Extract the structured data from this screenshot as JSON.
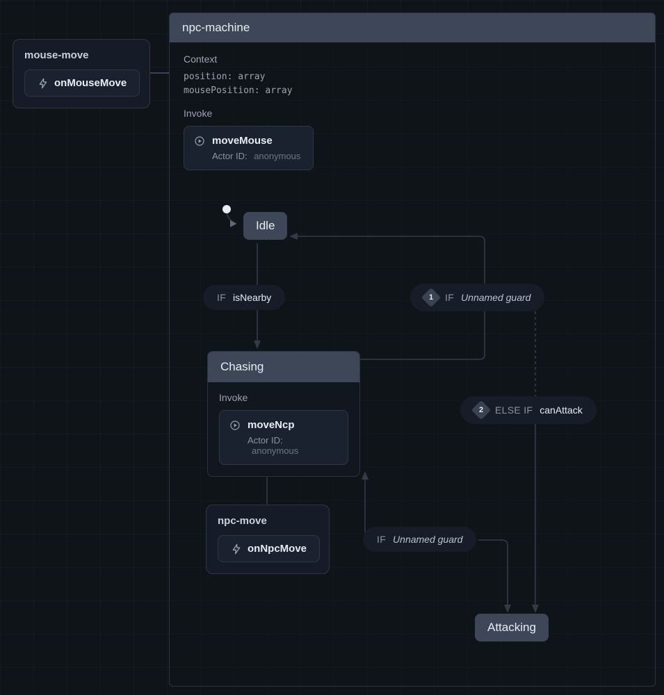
{
  "machine": {
    "name": "npc-machine",
    "context": {
      "heading": "Context",
      "entries": [
        {
          "key": "position",
          "type": "array"
        },
        {
          "key": "mousePosition",
          "type": "array"
        }
      ]
    },
    "invoke": {
      "heading": "Invoke",
      "name": "moveMouse",
      "actorIdLabel": "Actor ID:",
      "actorId": "anonymous"
    }
  },
  "events": {
    "mouseMove": {
      "title": "mouse-move",
      "action": "onMouseMove"
    },
    "npcMove": {
      "title": "npc-move",
      "action": "onNpcMove"
    }
  },
  "states": {
    "idle": {
      "label": "Idle"
    },
    "chasing": {
      "label": "Chasing",
      "invoke": {
        "heading": "Invoke",
        "name": "moveNcp",
        "actorIdLabel": "Actor ID:",
        "actorId": "anonymous"
      }
    },
    "attacking": {
      "label": "Attacking"
    }
  },
  "guards": {
    "isNearby": {
      "kw": "IF",
      "name": "isNearby"
    },
    "unnamed1": {
      "index": "1",
      "kw": "IF",
      "name": "Unnamed guard"
    },
    "canAttack": {
      "index": "2",
      "kw": "ELSE IF",
      "name": "canAttack"
    },
    "unnamed2": {
      "kw": "IF",
      "name": "Unnamed guard"
    }
  }
}
